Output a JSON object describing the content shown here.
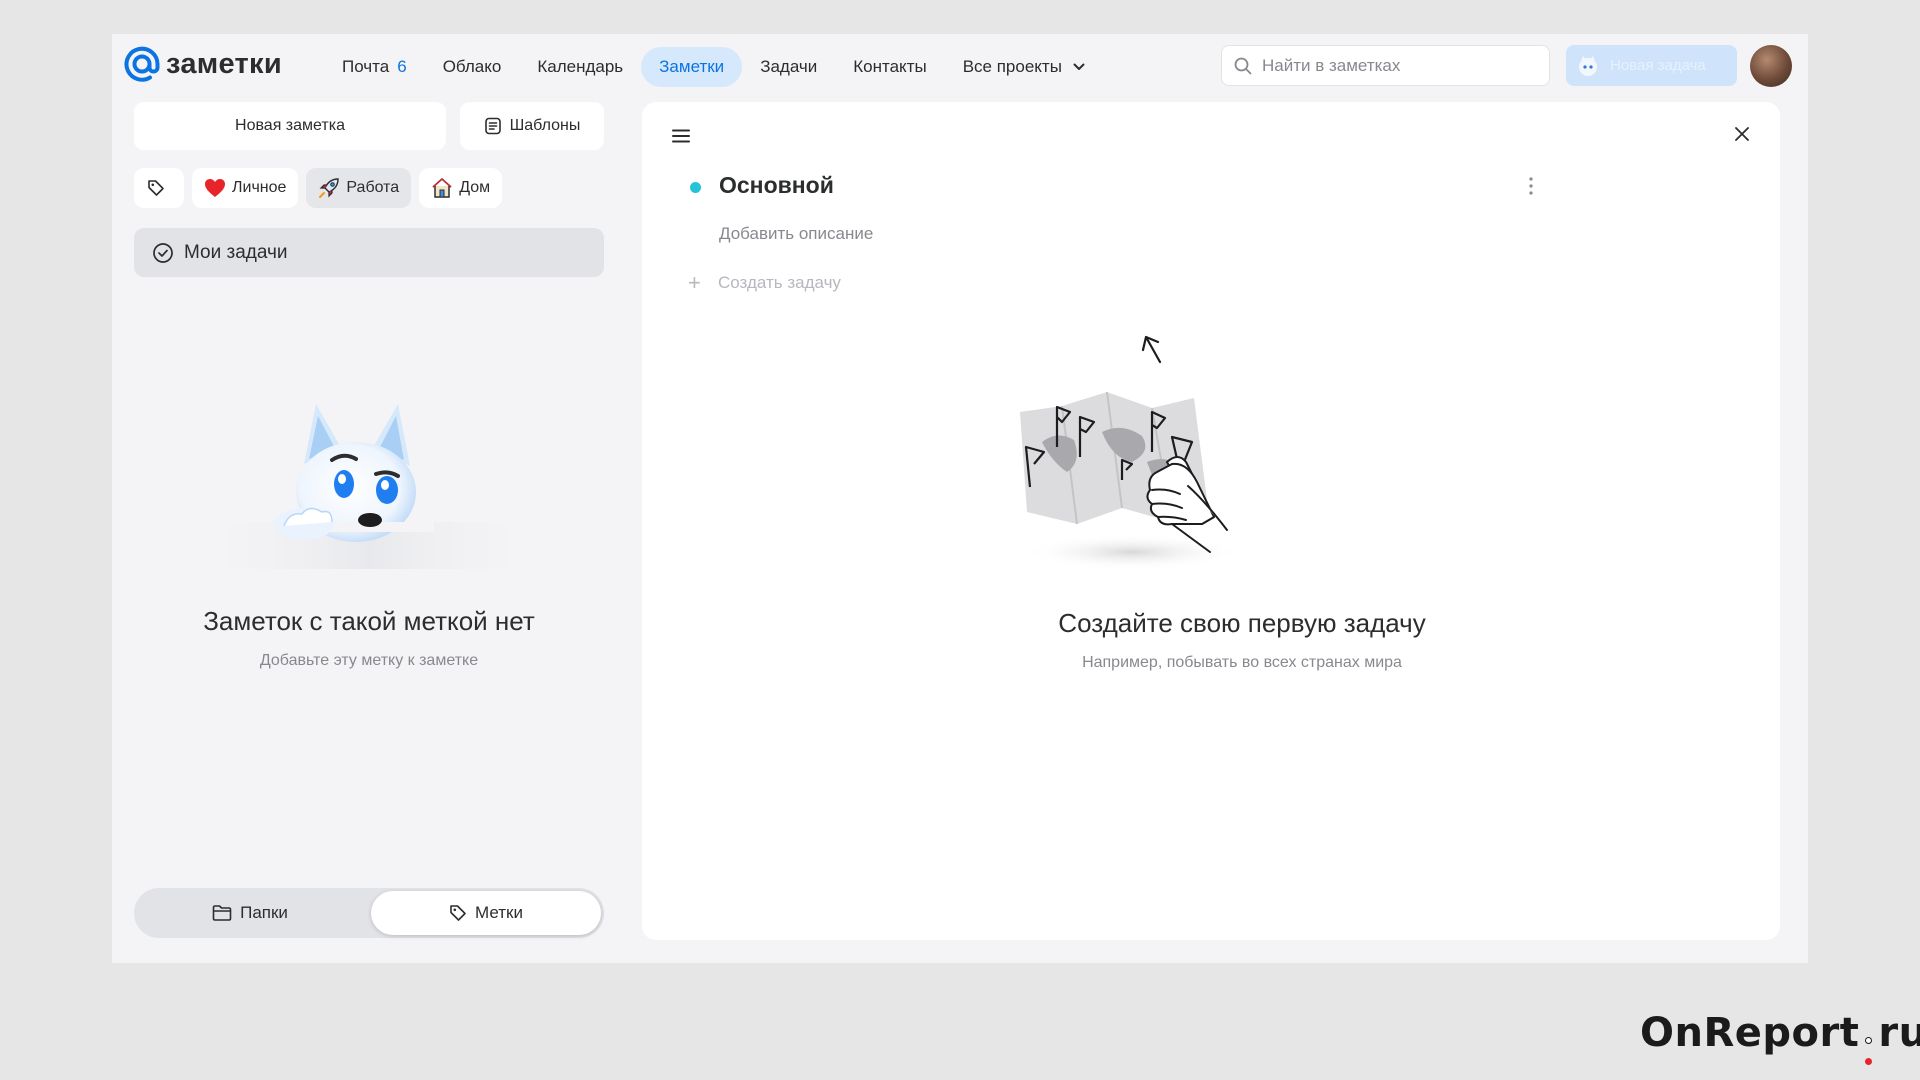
{
  "header": {
    "logo_text": "заметки",
    "nav": [
      {
        "label": "Почта",
        "badge": "6",
        "active": false
      },
      {
        "label": "Облако",
        "active": false
      },
      {
        "label": "Календарь",
        "active": false
      },
      {
        "label": "Заметки",
        "active": true
      },
      {
        "label": "Задачи",
        "active": false
      },
      {
        "label": "Контакты",
        "active": false
      },
      {
        "label": "Все проекты",
        "active": false,
        "dropdown": true
      }
    ],
    "search_placeholder": "Найти в заметках",
    "promo_label": "Новая задача"
  },
  "sidebar": {
    "new_note_label": "Новая заметка",
    "templates_label": "Шаблоны",
    "tags": [
      {
        "label": "Личное",
        "icon": "heart-icon",
        "selected": false
      },
      {
        "label": "Работа",
        "icon": "rocket-icon",
        "selected": true
      },
      {
        "label": "Дом",
        "icon": "house-icon",
        "selected": false
      }
    ],
    "my_tasks_label": "Мои задачи",
    "empty_title": "Заметок с такой меткой нет",
    "empty_subtitle": "Добавьте эту метку к заметке",
    "segment": {
      "folders_label": "Папки",
      "tags_label": "Метки",
      "active": "tags"
    }
  },
  "main": {
    "list_title": "Основной",
    "add_description": "Добавить описание",
    "create_task": "Создать задачу",
    "empty_title": "Создайте свою первую задачу",
    "empty_subtitle": "Например, побывать во всех странах мира"
  },
  "watermark": {
    "part1": "OnReport",
    "part2": "ru"
  },
  "colors": {
    "accent": "#0c74e2",
    "accent_bg": "#d6e8fb",
    "list_dot": "#23c3d9",
    "page_bg": "#f4f4f6"
  }
}
